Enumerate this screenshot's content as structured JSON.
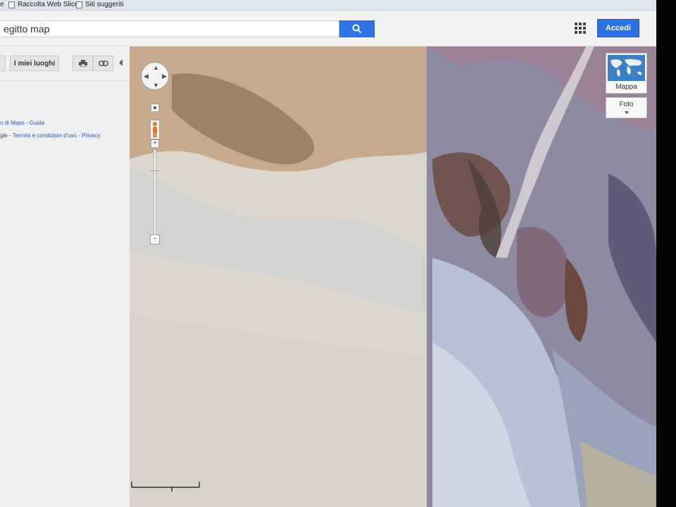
{
  "favorites": {
    "fragment": "e",
    "web_slice": "Raccolta Web Slice",
    "suggested": "Siti suggeriti"
  },
  "search": {
    "query": "egitto map",
    "icon": "search-icon"
  },
  "header": {
    "apps_icon": "apps-grid-icon",
    "signin_label": "Accedi",
    "signin_color": "#2f6fe4"
  },
  "left_panel": {
    "my_places_label": "I miei luoghi",
    "print_icon": "print-icon",
    "link_icon": "link-icon",
    "collapse_icon": "chevron-left-icon",
    "help_prefix": "o di Maps",
    "help_sep": " - ",
    "guide": "Guida",
    "legal_prefix": "gle",
    "terms": "Termini e condizioni d'uso",
    "privacy": "Privacy"
  },
  "map": {
    "map_type_label": "Mappa",
    "photos_label": "Foto",
    "pan_icon": "pan-control-icon",
    "zoom_in": "+",
    "zoom_out": "−",
    "pegman_icon": "pegman-icon"
  }
}
